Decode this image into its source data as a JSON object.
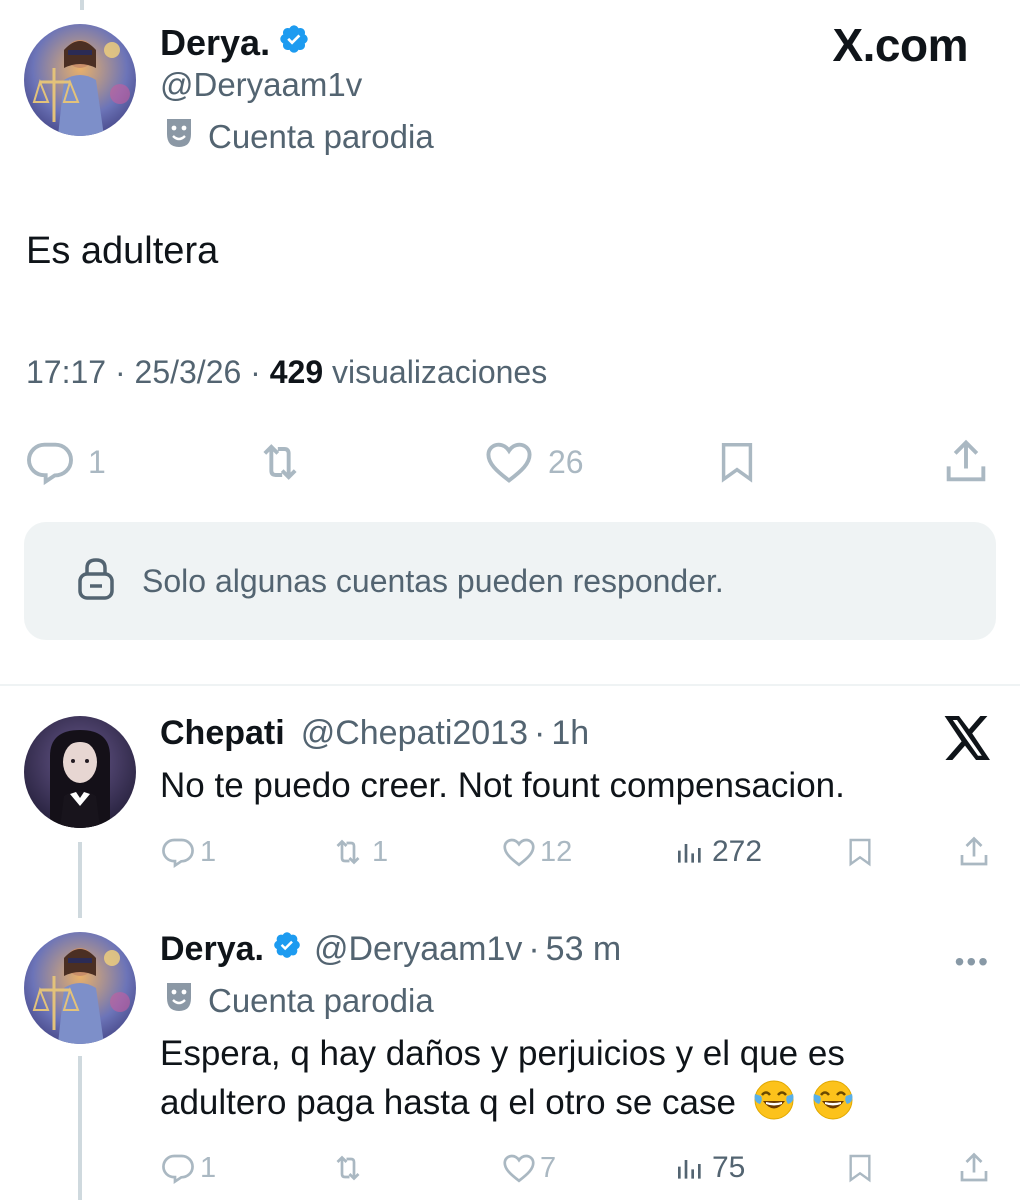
{
  "brand": "X.com",
  "main_tweet": {
    "name": "Derya.",
    "handle": "@Deryaam1v",
    "parody_label": "Cuenta parodia",
    "text": "Es adultera",
    "time": "17:17",
    "date": "25/3/26",
    "views_count": "429",
    "views_label": "visualizaciones",
    "actions": {
      "replies": "1",
      "reposts": "",
      "likes": "26"
    },
    "reply_restriction": "Solo algunas cuentas pueden responder."
  },
  "replies": [
    {
      "name": "Chepati",
      "handle": "@Chepati2013",
      "time": "1h",
      "text": "No te puedo creer. Not fount compensacion.",
      "actions": {
        "replies": "1",
        "reposts": "1",
        "likes": "12",
        "views": "272"
      }
    },
    {
      "name": "Derya.",
      "handle": "@Deryaam1v",
      "time": "53 m",
      "parody_label": "Cuenta parodia",
      "text_line1": "Espera, q hay daños y perjuicios y el que es",
      "text_line2": "adultero paga hasta q el otro se case",
      "actions": {
        "replies": "1",
        "reposts": "",
        "likes": "7",
        "views": "75"
      }
    }
  ],
  "colors": {
    "verified": "#1d9bf0",
    "secondary_text": "#536471",
    "faded_icons": "#aab8c2",
    "box_bg": "#eff3f4"
  }
}
